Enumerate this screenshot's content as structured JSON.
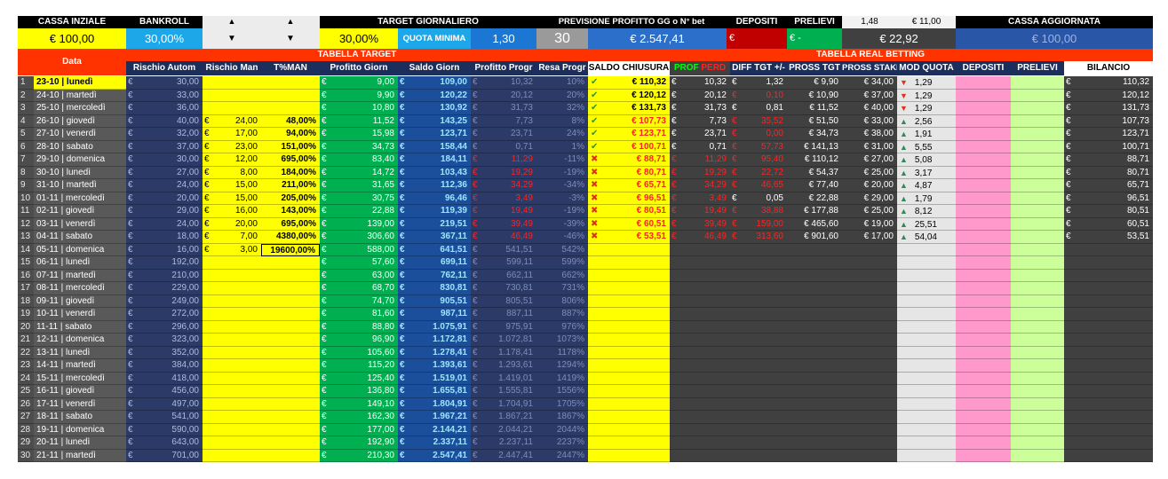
{
  "top": {
    "cassa_iniziale_label": "CASSA INZIALE",
    "cassa_iniziale_value": "€ 100,00",
    "bankroll_label": "BANKROLL",
    "bankroll_value": "30,00%",
    "target_label": "TARGET GIORNALIERO",
    "target_pct": "30,00%",
    "quota_minima_label": "QUOTA MINIMA",
    "quota_minima_value": "1,30",
    "days_value": "30",
    "previsione_label": "PREVISIONE PROFITTO GG o N° bet",
    "previsione_value": "€ 2.547,41",
    "depositi_label": "DEPOSITI",
    "depositi_value": "€",
    "prelievi_label": "PRELIEVI",
    "prelievi_value": "€      -",
    "quota_current": "1,48",
    "stake_current": "€ 11,00",
    "saldo_value": "€ 22,92",
    "cassa_agg_label": "CASSA AGGIORNATA",
    "cassa_agg_value": "€ 100,00"
  },
  "section_titles": {
    "tabella_target": "TABELLA TARGET",
    "tabella_real": "TABELLA REAL BETTING"
  },
  "headers": {
    "data": "Data",
    "rischio_autom": "Rischio Autom",
    "rischio_man": "Rischio Man",
    "tman": "T%MAN",
    "profitto_giorn": "Profitto Giorn",
    "saldo_giorn": "Saldo Giorn",
    "profitto_progr": "Profitto Progr",
    "resa_progr": "Resa Progr",
    "saldo_chiusura": "SALDO CHIUSURA",
    "prof": "PROF",
    "perd": "PERD",
    "diff_tgt": "DIFF TGT +/-",
    "pross_tgt": "PROSS TGT",
    "pross_stake": "PROSS STAKE",
    "mod_quota": "MOD QUOTA",
    "depositi": "DEPOSITI",
    "prelievi": "PRELIEVI",
    "bilancio": "BILANCIO"
  },
  "euro": "€",
  "rows": [
    {
      "n": "1",
      "date": "23-10 | lunedì",
      "ra": "30,00",
      "rm": "",
      "tm": "",
      "pg": "9,00",
      "sg": "109,00",
      "pp": "10,32",
      "rp": "10%",
      "sc": "€ 110,32",
      "status": "ok",
      "pf": "10,32",
      "dt": "1,32",
      "dtr": false,
      "pt": "€ 9,90",
      "ps": "€ 34,00",
      "trend": "down",
      "mq": "1,29",
      "bil": "110,32"
    },
    {
      "n": "2",
      "date": "24-10 | martedì",
      "ra": "33,00",
      "rm": "",
      "tm": "",
      "pg": "9,90",
      "sg": "120,22",
      "pp": "20,12",
      "rp": "20%",
      "sc": "€ 120,12",
      "status": "ok",
      "pf": "20,12",
      "dt": "0,10",
      "dtr": true,
      "pt": "€ 10,90",
      "ps": "€ 37,00",
      "trend": "down",
      "mq": "1,29",
      "bil": "120,12"
    },
    {
      "n": "3",
      "date": "25-10 | mercoledì",
      "ra": "36,00",
      "rm": "",
      "tm": "",
      "pg": "10,80",
      "sg": "130,92",
      "pp": "31,73",
      "rp": "32%",
      "sc": "€ 131,73",
      "status": "ok",
      "pf": "31,73",
      "dt": "0,81",
      "dtr": false,
      "pt": "€ 11,52",
      "ps": "€ 40,00",
      "trend": "down",
      "mq": "1,29",
      "bil": "131,73"
    },
    {
      "n": "4",
      "date": "26-10 | giovedì",
      "ra": "40,00",
      "rm": "24,00",
      "tm": "48,00%",
      "pg": "11,52",
      "sg": "143,25",
      "pp": "7,73",
      "rp": "8%",
      "sc": "€ 107,73",
      "status": "ok",
      "pf": "7,73",
      "dt": "35,52",
      "dtr": true,
      "pt": "€ 51,50",
      "ps": "€ 33,00",
      "trend": "up",
      "mq": "2,56",
      "bil": "107,73"
    },
    {
      "n": "5",
      "date": "27-10 | venerdì",
      "ra": "32,00",
      "rm": "17,00",
      "tm": "94,00%",
      "pg": "15,98",
      "sg": "123,71",
      "pp": "23,71",
      "rp": "24%",
      "sc": "€ 123,71",
      "status": "ok",
      "pf": "23,71",
      "dt": "0,00",
      "dtr": true,
      "pt": "€ 34,73",
      "ps": "€ 38,00",
      "trend": "up",
      "mq": "1,91",
      "bil": "123,71"
    },
    {
      "n": "6",
      "date": "28-10 | sabato",
      "ra": "37,00",
      "rm": "23,00",
      "tm": "151,00%",
      "pg": "34,73",
      "sg": "158,44",
      "pp": "0,71",
      "rp": "1%",
      "sc": "€ 100,71",
      "status": "ok",
      "pf": "0,71",
      "dt": "57,73",
      "dtr": true,
      "pt": "€ 141,13",
      "ps": "€ 31,00",
      "trend": "up",
      "mq": "5,55",
      "bil": "100,71"
    },
    {
      "n": "7",
      "date": "29-10 | domenica",
      "ra": "30,00",
      "rm": "12,00",
      "tm": "695,00%",
      "pg": "83,40",
      "sg": "184,11",
      "pp": "11,29",
      "rp": "-11%",
      "ppr": true,
      "sc": "€ 88,71",
      "status": "x",
      "pf": "11,29",
      "dt": "95,40",
      "dtr": true,
      "pt": "€ 110,12",
      "ps": "€ 27,00",
      "trend": "up",
      "mq": "5,08",
      "bil": "88,71"
    },
    {
      "n": "8",
      "date": "30-10 | lunedì",
      "ra": "27,00",
      "rm": "8,00",
      "tm": "184,00%",
      "pg": "14,72",
      "sg": "103,43",
      "pp": "19,29",
      "rp": "-19%",
      "ppr": true,
      "sc": "€ 80,71",
      "status": "x",
      "pf": "19,29",
      "dt": "22,72",
      "dtr": true,
      "pt": "€ 54,37",
      "ps": "€ 25,00",
      "trend": "up",
      "mq": "3,17",
      "bil": "80,71"
    },
    {
      "n": "9",
      "date": "31-10 | martedì",
      "ra": "24,00",
      "rm": "15,00",
      "tm": "211,00%",
      "pg": "31,65",
      "sg": "112,36",
      "pp": "34,29",
      "rp": "-34%",
      "ppr": true,
      "sc": "€ 65,71",
      "status": "x",
      "pf": "34,29",
      "dt": "46,65",
      "dtr": true,
      "pt": "€ 77,40",
      "ps": "€ 20,00",
      "trend": "up",
      "mq": "4,87",
      "bil": "65,71"
    },
    {
      "n": "10",
      "date": "01-11 | mercoledì",
      "ra": "20,00",
      "rm": "15,00",
      "tm": "205,00%",
      "pg": "30,75",
      "sg": "96,46",
      "pp": "3,49",
      "rp": "-3%",
      "ppr": true,
      "sc": "€ 96,51",
      "status": "x",
      "pf": "3,49",
      "dt": "0,05",
      "dtr": false,
      "pt": "€ 22,88",
      "ps": "€ 29,00",
      "trend": "up",
      "mq": "1,79",
      "bil": "96,51"
    },
    {
      "n": "11",
      "date": "02-11 | giovedì",
      "ra": "29,00",
      "rm": "16,00",
      "tm": "143,00%",
      "pg": "22,88",
      "sg": "119,39",
      "pp": "19,49",
      "rp": "-19%",
      "ppr": true,
      "sc": "€ 80,51",
      "status": "x",
      "pf": "19,49",
      "dt": "38,88",
      "dtr": true,
      "pt": "€ 177,88",
      "ps": "€ 25,00",
      "trend": "up",
      "mq": "8,12",
      "bil": "80,51"
    },
    {
      "n": "12",
      "date": "03-11 | venerdì",
      "ra": "24,00",
      "rm": "20,00",
      "tm": "695,00%",
      "pg": "139,00",
      "sg": "219,51",
      "pp": "39,49",
      "rp": "-39%",
      "ppr": true,
      "sc": "€ 60,51",
      "status": "x",
      "pf": "39,49",
      "dt": "159,00",
      "dtr": true,
      "pt": "€ 465,60",
      "ps": "€ 19,00",
      "trend": "up",
      "mq": "25,51",
      "bil": "60,51"
    },
    {
      "n": "13",
      "date": "04-11 | sabato",
      "ra": "18,00",
      "rm": "7,00",
      "tm": "4380,00%",
      "pg": "306,60",
      "sg": "367,11",
      "pp": "46,49",
      "rp": "-46%",
      "ppr": true,
      "sc": "€ 53,51",
      "status": "x",
      "pf": "46,49",
      "dt": "313,60",
      "dtr": true,
      "pt": "€ 901,60",
      "ps": "€ 17,00",
      "trend": "up",
      "mq": "54,04",
      "bil": "53,51"
    },
    {
      "n": "14",
      "date": "05-11 | domenica",
      "ra": "16,00",
      "rm": "3,00",
      "tm": "19600,00%",
      "pg": "588,00",
      "sg": "641,51",
      "pp": "541,51",
      "rp": "542%"
    },
    {
      "n": "15",
      "date": "06-11 | lunedì",
      "ra": "192,00",
      "pg": "57,60",
      "sg": "699,11",
      "pp": "599,11",
      "rp": "599%"
    },
    {
      "n": "16",
      "date": "07-11 | martedì",
      "ra": "210,00",
      "pg": "63,00",
      "sg": "762,11",
      "pp": "662,11",
      "rp": "662%"
    },
    {
      "n": "17",
      "date": "08-11 | mercoledì",
      "ra": "229,00",
      "pg": "68,70",
      "sg": "830,81",
      "pp": "730,81",
      "rp": "731%"
    },
    {
      "n": "18",
      "date": "09-11 | giovedì",
      "ra": "249,00",
      "pg": "74,70",
      "sg": "905,51",
      "pp": "805,51",
      "rp": "806%"
    },
    {
      "n": "19",
      "date": "10-11 | venerdì",
      "ra": "272,00",
      "pg": "81,60",
      "sg": "987,11",
      "pp": "887,11",
      "rp": "887%"
    },
    {
      "n": "20",
      "date": "11-11 | sabato",
      "ra": "296,00",
      "pg": "88,80",
      "sg": "1.075,91",
      "pp": "975,91",
      "rp": "976%"
    },
    {
      "n": "21",
      "date": "12-11 | domenica",
      "ra": "323,00",
      "pg": "96,90",
      "sg": "1.172,81",
      "pp": "1.072,81",
      "rp": "1073%"
    },
    {
      "n": "22",
      "date": "13-11 | lunedì",
      "ra": "352,00",
      "pg": "105,60",
      "sg": "1.278,41",
      "pp": "1.178,41",
      "rp": "1178%"
    },
    {
      "n": "23",
      "date": "14-11 | martedì",
      "ra": "384,00",
      "pg": "115,20",
      "sg": "1.393,61",
      "pp": "1.293,61",
      "rp": "1294%"
    },
    {
      "n": "24",
      "date": "15-11 | mercoledì",
      "ra": "418,00",
      "pg": "125,40",
      "sg": "1.519,01",
      "pp": "1.419,01",
      "rp": "1419%"
    },
    {
      "n": "25",
      "date": "16-11 | giovedì",
      "ra": "456,00",
      "pg": "136,80",
      "sg": "1.655,81",
      "pp": "1.555,81",
      "rp": "1556%"
    },
    {
      "n": "26",
      "date": "17-11 | venerdì",
      "ra": "497,00",
      "pg": "149,10",
      "sg": "1.804,91",
      "pp": "1.704,91",
      "rp": "1705%"
    },
    {
      "n": "27",
      "date": "18-11 | sabato",
      "ra": "541,00",
      "pg": "162,30",
      "sg": "1.967,21",
      "pp": "1.867,21",
      "rp": "1867%"
    },
    {
      "n": "28",
      "date": "19-11 | domenica",
      "ra": "590,00",
      "pg": "177,00",
      "sg": "2.144,21",
      "pp": "2.044,21",
      "rp": "2044%"
    },
    {
      "n": "29",
      "date": "20-11 | lunedì",
      "ra": "643,00",
      "pg": "192,90",
      "sg": "2.337,11",
      "pp": "2.237,11",
      "rp": "2237%"
    },
    {
      "n": "30",
      "date": "21-11 | martedì",
      "ra": "701,00",
      "pg": "210,30",
      "sg": "2.547,41",
      "pp": "2.447,41",
      "rp": "2447%"
    }
  ]
}
